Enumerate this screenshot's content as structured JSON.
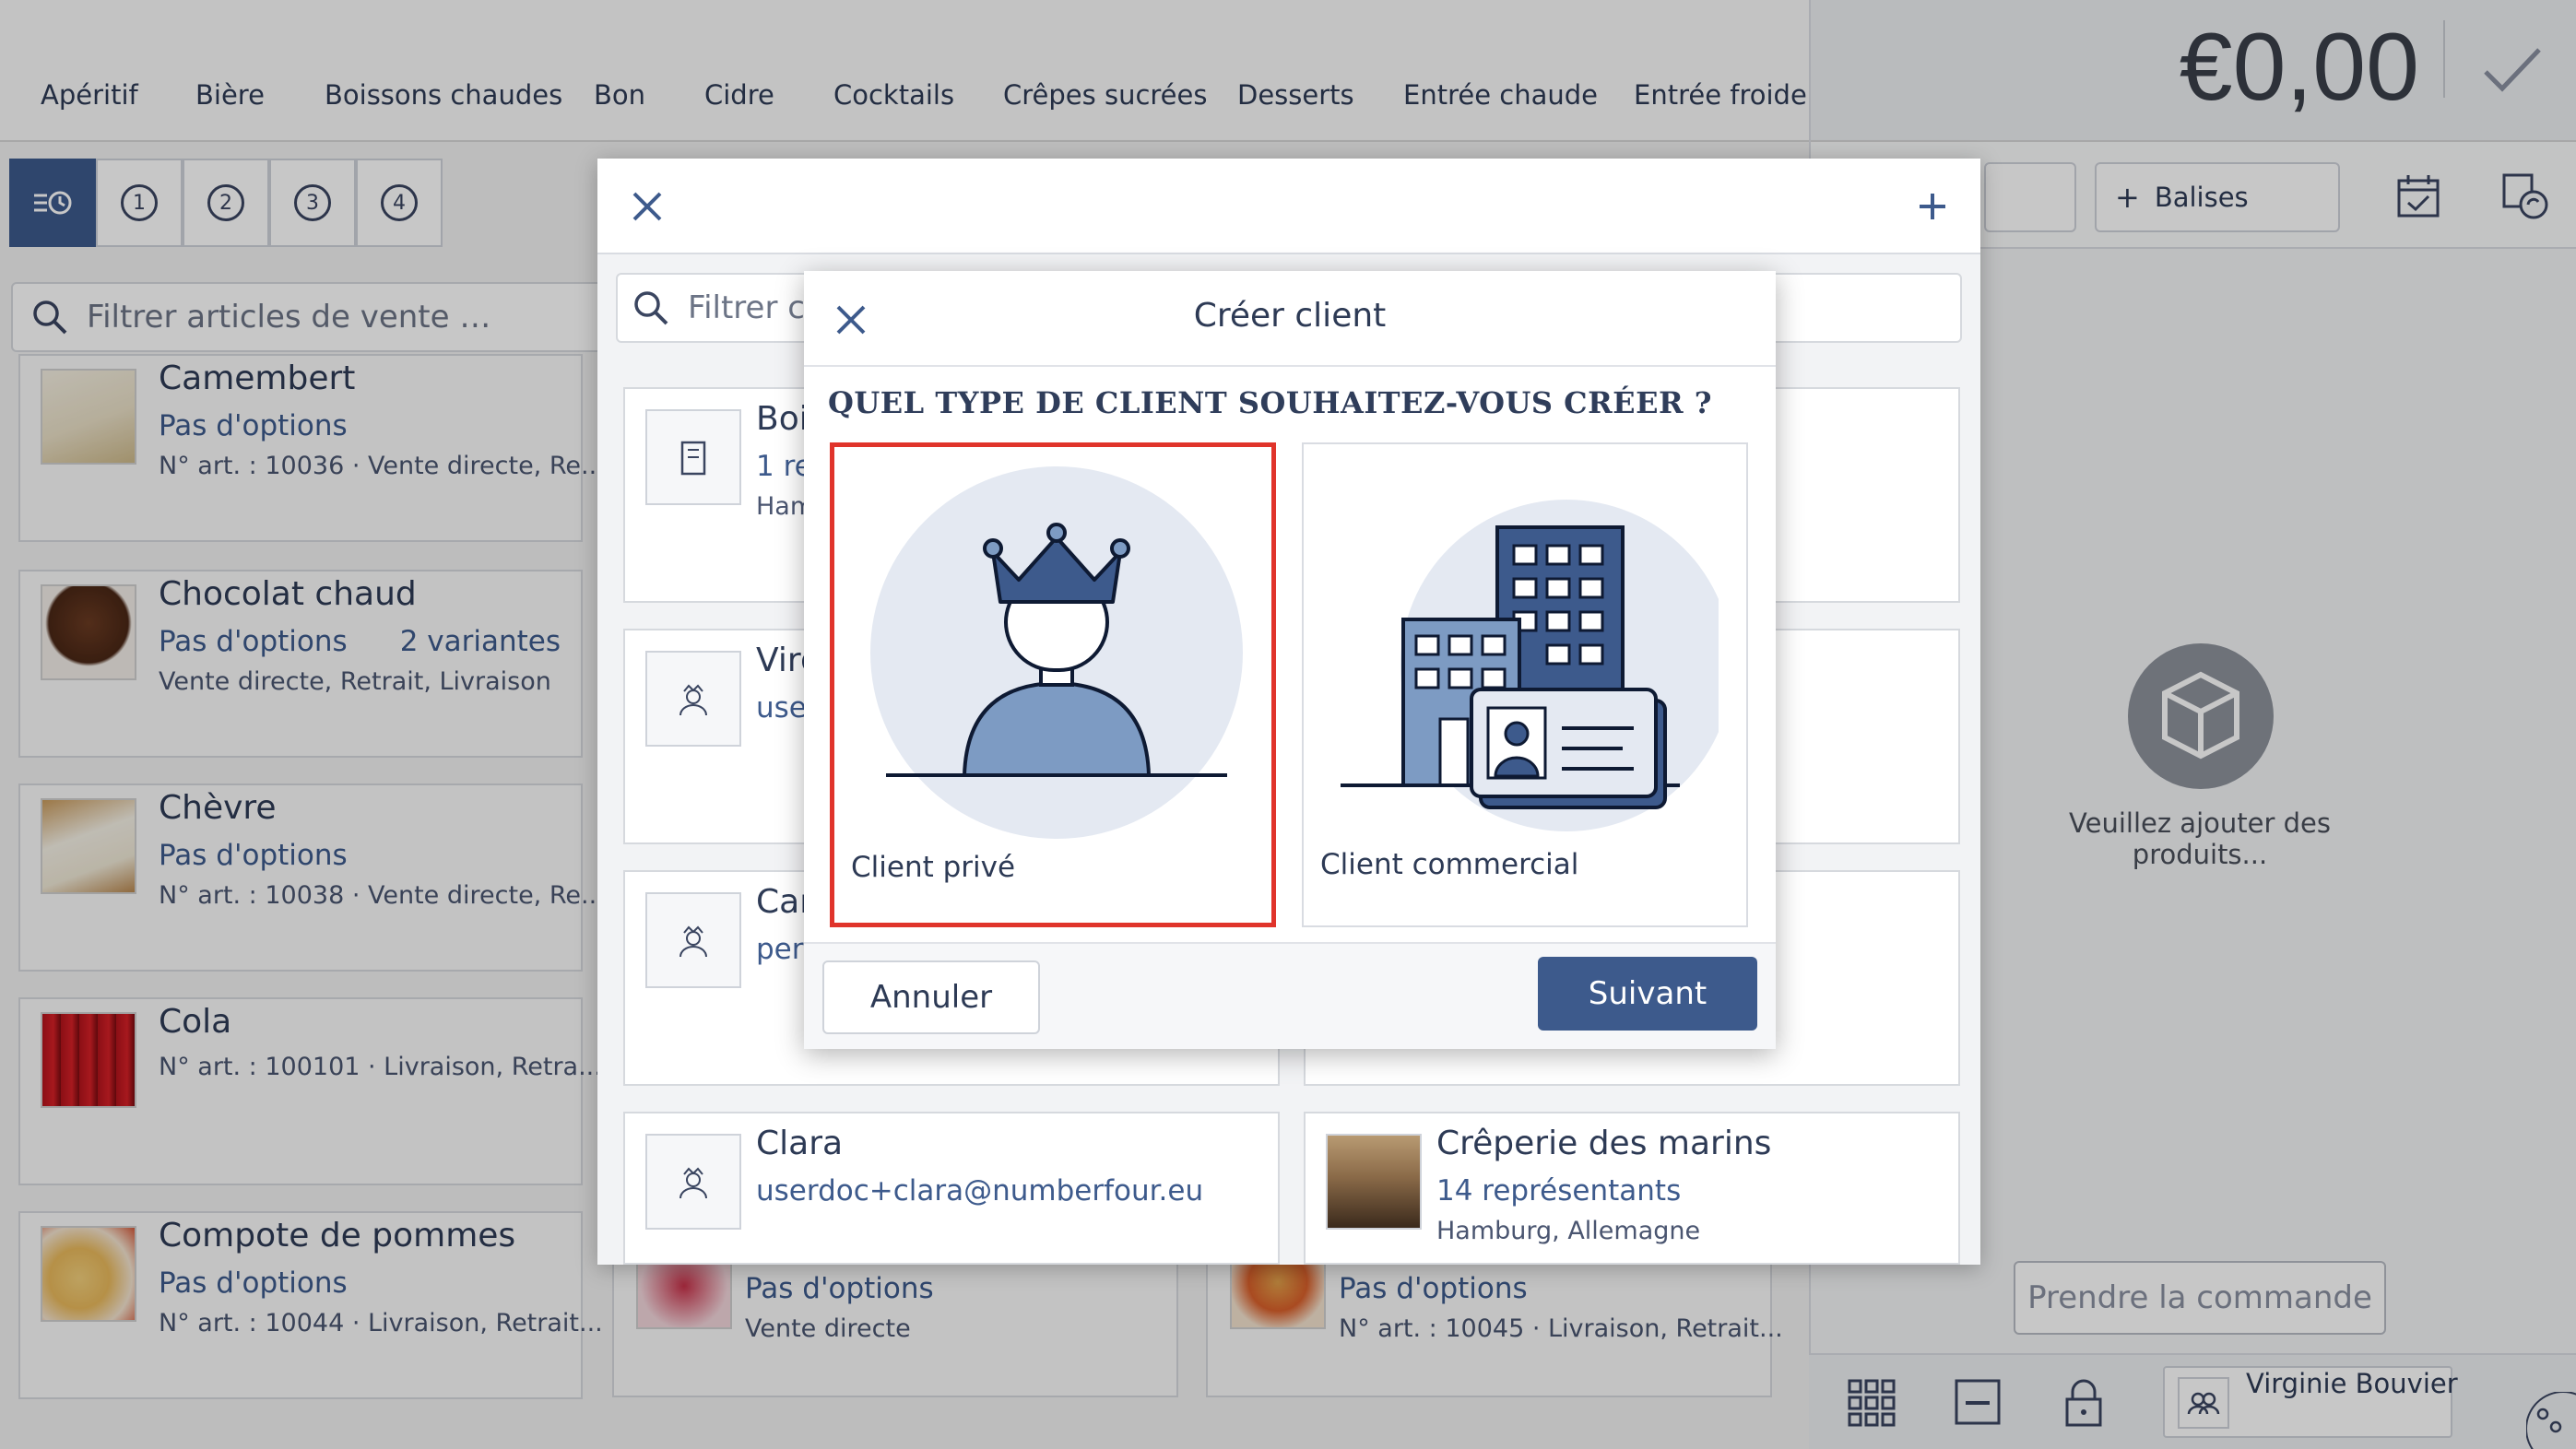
{
  "categories": [
    "Apéritif",
    "Bière",
    "Boissons chaudes",
    "Bon",
    "Cidre",
    "Cocktails",
    "Crêpes sucrées",
    "Desserts",
    "Entrée chaude",
    "Entrée froide"
  ],
  "view_buttons": [
    "1",
    "2",
    "3",
    "4"
  ],
  "product_search": {
    "placeholder": "Filtrer articles de vente …"
  },
  "products": [
    {
      "name": "Camembert",
      "options": "Pas d'options",
      "meta": "N° art. : 10036 · Vente directe, Re..."
    },
    {
      "name": "Chocolat chaud",
      "options": "Pas d'options",
      "variants": "2 variantes",
      "meta": "Vente directe, Retrait, Livraison"
    },
    {
      "name": "Chèvre",
      "options": "Pas d'options",
      "meta": "N° art. : 10038 · Vente directe, Re..."
    },
    {
      "name": "Cola",
      "meta": "N° art. : 100101 · Livraison, Retra..."
    },
    {
      "name": "Compote de pommes",
      "options": "Pas d'options",
      "meta": "N° art. : 10044 · Livraison, Retrait..."
    }
  ],
  "products_col2": [
    {
      "options": "Pas d'options",
      "meta": "Vente directe"
    },
    {
      "options": "Pas d'options",
      "meta": "N° art. : 10045 · Livraison, Retrait..."
    }
  ],
  "order": {
    "total": "€0,00",
    "tags_button": "Balises",
    "empty_text": "Veuillez ajouter des produits...",
    "take_order_button": "Prendre la commande",
    "user_name": "Virginie Bouvier"
  },
  "client_list": {
    "search_placeholder": "Filtrer cl",
    "clients": [
      {
        "name": "Boi",
        "sub": "1 re",
        "meta": "Ham"
      },
      {
        "name": "Virg",
        "sub": "user"
      },
      {
        "name": "Can",
        "sub": "pers"
      },
      {
        "name": "Clara",
        "sub": "userdoc+clara@numberfour.eu"
      },
      {
        "name": "Crêperie des marins",
        "sub": "14 représentants",
        "meta": "Hamburg, Allemagne"
      }
    ]
  },
  "create_dialog": {
    "title": "Créer client",
    "question": "QUEL TYPE DE CLIENT SOUHAITEZ-VOUS CRÉER ?",
    "options": [
      {
        "label": "Client privé",
        "selected": true
      },
      {
        "label": "Client commercial",
        "selected": false
      }
    ],
    "cancel_label": "Annuler",
    "next_label": "Suivant"
  },
  "colors": {
    "accent": "#3d5a8c",
    "selection": "#e0342b"
  }
}
